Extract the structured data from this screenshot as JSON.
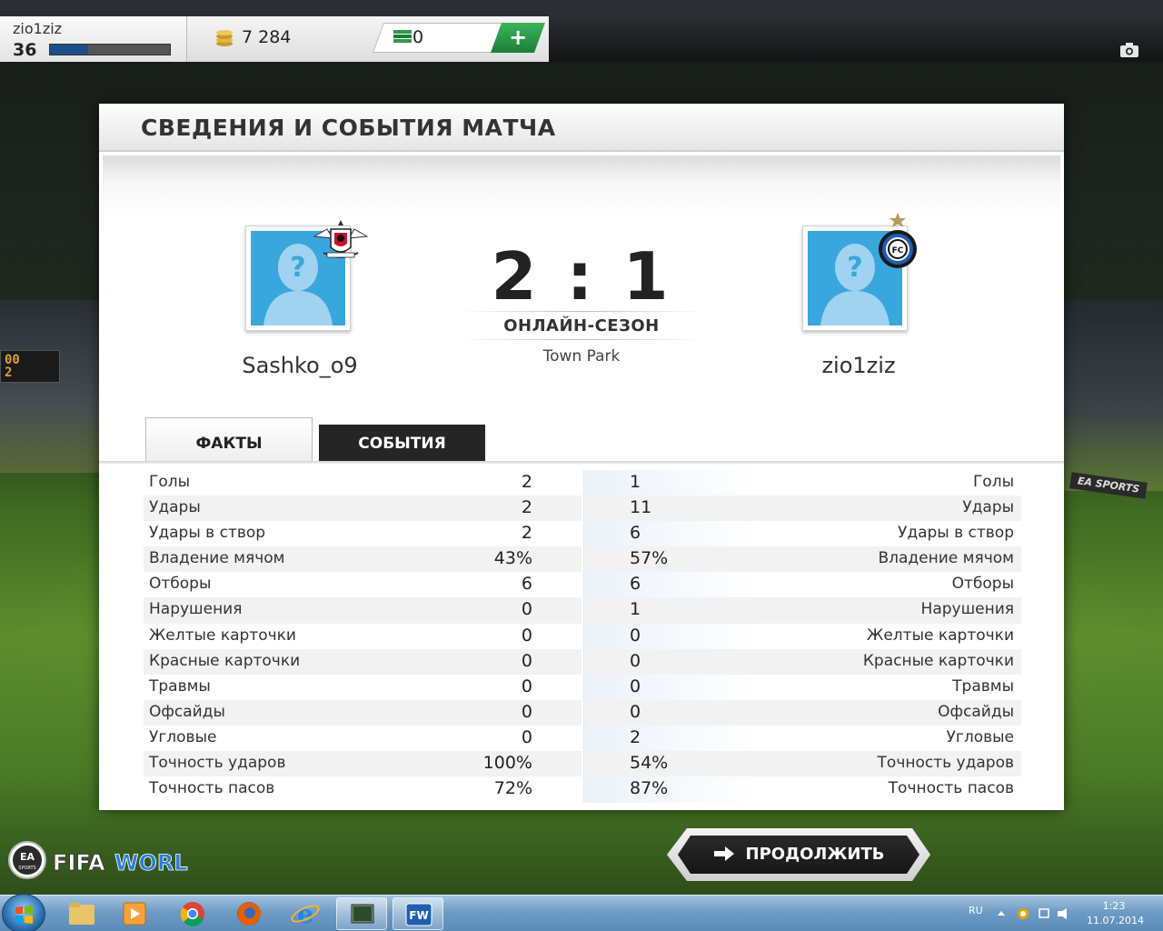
{
  "topbar": {
    "player_name": "zio1ziz",
    "player_level": "36",
    "xp_fraction": 0.32,
    "coins": "7 284",
    "fifa_points": "0",
    "add_button": "+"
  },
  "panel": {
    "title": "СВЕДЕНИЯ И СОБЫТИЯ МАТЧА",
    "home_name": "Sashko_o9",
    "away_name": "zio1ziz",
    "score": "2 : 1",
    "mode": "ОНЛАЙН-СЕЗОН",
    "stadium": "Town Park"
  },
  "tabs": {
    "facts": "ФАКТЫ",
    "events": "СОБЫТИЯ"
  },
  "stats": [
    {
      "label": "Голы",
      "home": "2",
      "away": "1"
    },
    {
      "label": "Удары",
      "home": "2",
      "away": "11"
    },
    {
      "label": "Удары в створ",
      "home": "2",
      "away": "6"
    },
    {
      "label": "Владение мячом",
      "home": "43%",
      "away": "57%"
    },
    {
      "label": "Отборы",
      "home": "6",
      "away": "6"
    },
    {
      "label": "Нарушения",
      "home": "0",
      "away": "1"
    },
    {
      "label": "Желтые карточки",
      "home": "0",
      "away": "0"
    },
    {
      "label": "Красные карточки",
      "home": "0",
      "away": "0"
    },
    {
      "label": "Травмы",
      "home": "0",
      "away": "0"
    },
    {
      "label": "Офсайды",
      "home": "0",
      "away": "0"
    },
    {
      "label": "Угловые",
      "home": "0",
      "away": "2"
    },
    {
      "label": "Точность ударов",
      "home": "100%",
      "away": "54%"
    },
    {
      "label": "Точность пасов",
      "home": "72%",
      "away": "87%"
    }
  ],
  "bottom": {
    "continue": "ПРОДОЛЖИТЬ",
    "logo_ea": "EA SPORTS",
    "logo_fifaworld": "FIFAWORLD"
  },
  "background": {
    "scoreboard": "00\n2",
    "ad_board": "EA SPORTS"
  },
  "taskbar": {
    "lang": "RU",
    "time": "1:23",
    "date": "11.07.2014",
    "fw_label": "FW"
  },
  "colors": {
    "avatar_blue": "#3aa6de",
    "xp_blue": "#1b4f8a",
    "plus_green": "#1b7f37",
    "dark_button": "#1f1f1f"
  }
}
